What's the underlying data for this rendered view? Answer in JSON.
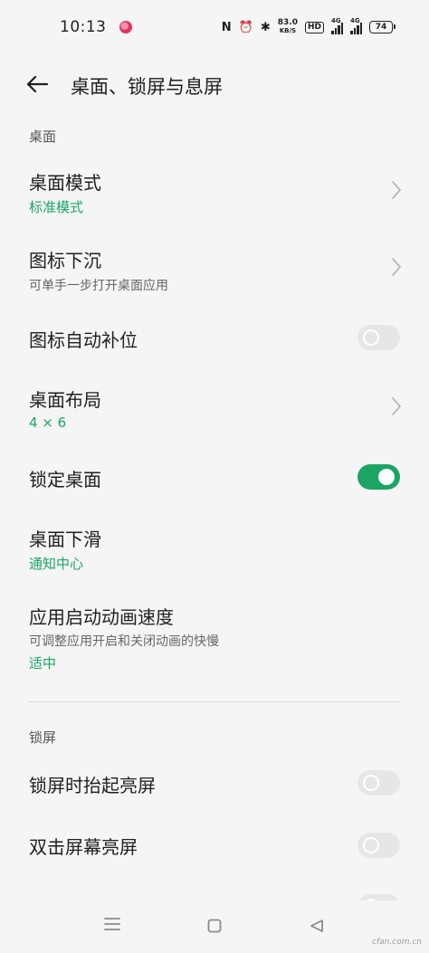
{
  "status_bar": {
    "time": "10:13",
    "nfc": "N",
    "alarm": "⏰",
    "bluetooth": "✱",
    "speed_value": "83.0",
    "speed_unit": "KB/S",
    "hd": "HD",
    "net1": "4G",
    "net2": "4G",
    "battery": "74"
  },
  "header": {
    "title": "桌面、锁屏与息屏"
  },
  "sections": {
    "desktop": "桌面",
    "lockscreen": "锁屏"
  },
  "rows": {
    "desktop_mode": {
      "title": "桌面模式",
      "value": "标准模式"
    },
    "icon_sink": {
      "title": "图标下沉",
      "subtitle": "可单手一步打开桌面应用"
    },
    "icon_autofill": {
      "title": "图标自动补位",
      "toggle": false
    },
    "desktop_layout": {
      "title": "桌面布局",
      "value": "4 × 6"
    },
    "lock_desktop": {
      "title": "锁定桌面",
      "toggle": true
    },
    "desktop_swipe": {
      "title": "桌面下滑",
      "value": "通知中心"
    },
    "app_anim_speed": {
      "title": "应用启动动画速度",
      "subtitle": "可调整应用开启和关闭动画的快慢",
      "value": "适中"
    },
    "raise_to_wake": {
      "title": "锁屏时抬起亮屏",
      "toggle": false
    },
    "double_tap_wake": {
      "title": "双击屏幕亮屏",
      "toggle": false
    }
  },
  "watermark": "cfan.com.cn",
  "colors": {
    "accent": "#1aa564",
    "background": "#f5f5f5",
    "toggle_off": "#e6e6e6"
  },
  "icons": {
    "back": "arrow-left-icon",
    "chevron": "chevron-right-icon",
    "nav_menu": "menu-icon",
    "nav_home": "square-icon",
    "nav_back": "triangle-back-icon"
  }
}
